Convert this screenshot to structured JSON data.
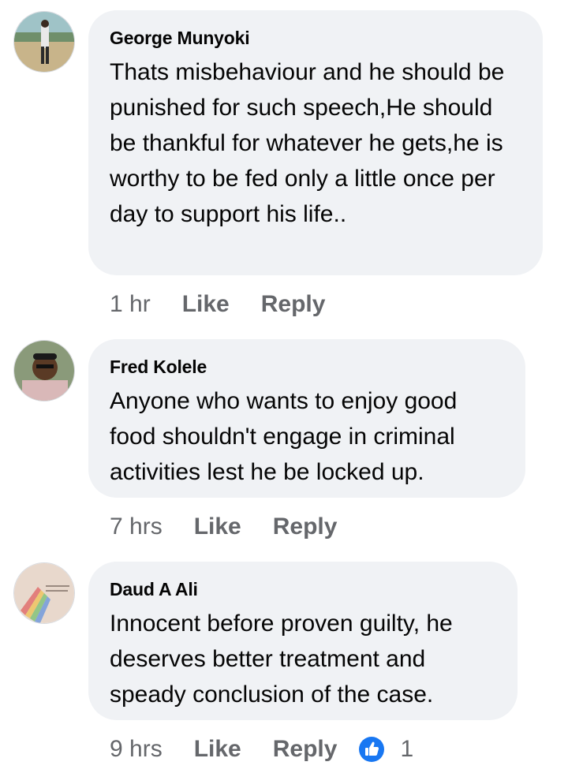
{
  "comments": [
    {
      "author": "George Munyoki",
      "text": "Thats misbehaviour and he should be punished for such speech,He should be thankful for whatever he gets,he is worthy to be fed only a little once per day to support his life..",
      "time": "1 hr",
      "like_label": "Like",
      "reply_label": "Reply"
    },
    {
      "author": "Fred Kolele",
      "text": "Anyone who wants to enjoy good food shouldn't engage in criminal activities lest he be locked up.",
      "time": "7 hrs",
      "like_label": "Like",
      "reply_label": "Reply"
    },
    {
      "author": "Daud A Ali",
      "text": "Innocent before proven guilty, he deserves better treatment and speady conclusion of the case.",
      "time": "9 hrs",
      "like_label": "Like",
      "reply_label": "Reply",
      "reaction_icon": "thumbs-up-icon",
      "reaction_count": "1"
    }
  ],
  "colors": {
    "bubble": "#f0f2f5",
    "meta": "#65676b",
    "like_blue": "#1877f2"
  }
}
